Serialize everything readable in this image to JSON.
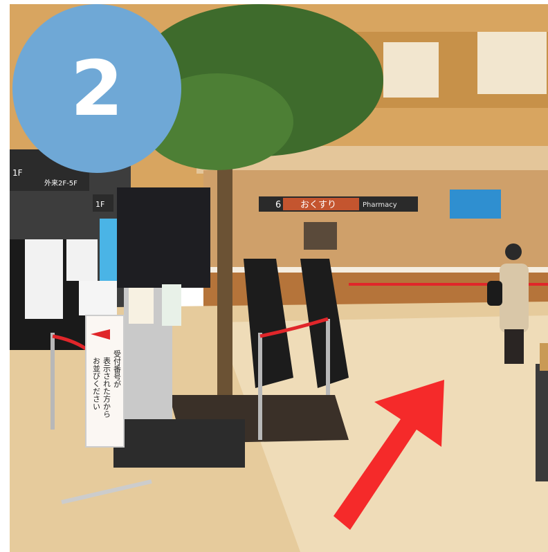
{
  "step_badge": {
    "number": "2",
    "color": "#6fa8d6"
  },
  "signs": {
    "floor_left": "1F",
    "floor_upper": "外来2F-5F",
    "counter_number": "6",
    "counter_name": "おくすり",
    "counter_english": "Pharmacy",
    "floor_1f": "1F",
    "standing_sign_vertical_1": "受付番号が",
    "standing_sign_vertical_2": "表示された方から",
    "standing_sign_vertical_3": "お並びください"
  },
  "arrow": {
    "color": "#f52a2a",
    "direction": "up-right"
  },
  "colors": {
    "wall_wood": "#d9a55c",
    "floor": "#e8cfa3",
    "rope": "#e0262a",
    "kiosk_screen": "#1e1e22"
  }
}
